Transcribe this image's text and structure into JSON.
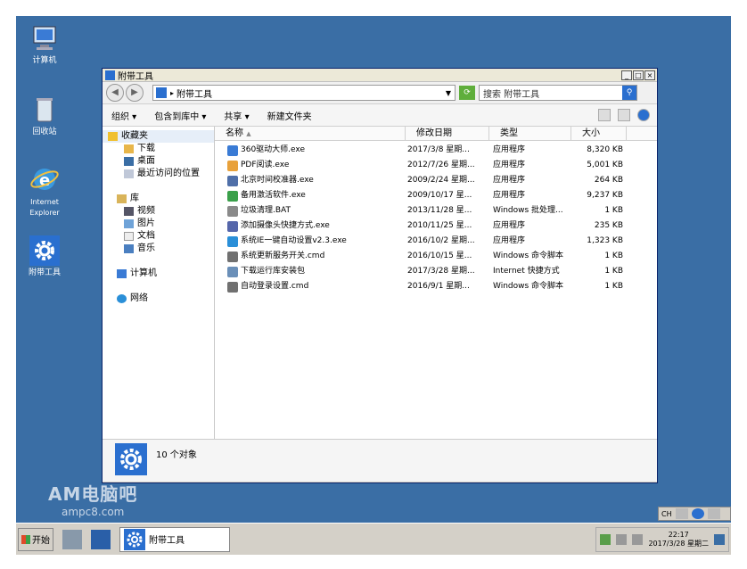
{
  "desktop": {
    "icons": [
      {
        "label": "计算机",
        "icon": "computer-icon"
      },
      {
        "label": "回收站",
        "icon": "recycle-bin-icon"
      },
      {
        "label": "Internet Explorer",
        "icon": "ie-icon"
      },
      {
        "label": "附带工具",
        "icon": "gear-icon"
      }
    ]
  },
  "window": {
    "title": "附带工具",
    "address": {
      "path": "附带工具"
    },
    "search_placeholder": "搜索 附带工具",
    "toolbar": {
      "organize": "组织",
      "include": "包含到库中",
      "share": "共享",
      "new_folder": "新建文件夹"
    },
    "nav": {
      "favorites": "收藏夹",
      "favorites_items": [
        "下载",
        "桌面",
        "最近访问的位置"
      ],
      "library": "库",
      "library_items": [
        "视频",
        "图片",
        "文档",
        "音乐"
      ],
      "computer": "计算机",
      "network": "网络"
    },
    "columns": {
      "name": "名称",
      "date": "修改日期",
      "type": "类型",
      "size": "大小"
    },
    "files": [
      {
        "name": "360驱动大师.exe",
        "date": "2017/3/8 星期...",
        "type": "应用程序",
        "size": "8,320 KB",
        "color": "#3a7bd5"
      },
      {
        "name": "PDF阅读.exe",
        "date": "2012/7/26 星期...",
        "type": "应用程序",
        "size": "5,001 KB",
        "color": "#e8a13b"
      },
      {
        "name": "北京时间校准器.exe",
        "date": "2009/2/24 星期...",
        "type": "应用程序",
        "size": "264 KB",
        "color": "#4f6fa8"
      },
      {
        "name": "备用激活软件.exe",
        "date": "2009/10/17 星...",
        "type": "应用程序",
        "size": "9,237 KB",
        "color": "#3aa04a"
      },
      {
        "name": "垃圾清理.BAT",
        "date": "2013/11/28 星...",
        "type": "Windows 批处理...",
        "size": "1 KB",
        "color": "#8a8a8a"
      },
      {
        "name": "添加摄像头快捷方式.exe",
        "date": "2010/11/25 星...",
        "type": "应用程序",
        "size": "235 KB",
        "color": "#5566aa"
      },
      {
        "name": "系统IE一键自动设置v2.3.exe",
        "date": "2016/10/2 星期...",
        "type": "应用程序",
        "size": "1,323 KB",
        "color": "#2a8fd8"
      },
      {
        "name": "系统更新服务开关.cmd",
        "date": "2016/10/15 星...",
        "type": "Windows 命令脚本",
        "size": "1 KB",
        "color": "#707070"
      },
      {
        "name": "下载运行库安装包",
        "date": "2017/3/28 星期...",
        "type": "Internet 快捷方式",
        "size": "1 KB",
        "color": "#6a8fb8"
      },
      {
        "name": "自动登录设置.cmd",
        "date": "2016/9/1 星期...",
        "type": "Windows 命令脚本",
        "size": "1 KB",
        "color": "#707070"
      }
    ],
    "details": {
      "count": "10 个对象"
    }
  },
  "watermark": {
    "line1": "AM电脑吧",
    "line2": "ampc8.com"
  },
  "langbar": {
    "lang": "CH"
  },
  "taskbar": {
    "start": "开始",
    "task": "附带工具",
    "clock_time": "22:17",
    "clock_date": "2017/3/28 星期二"
  }
}
